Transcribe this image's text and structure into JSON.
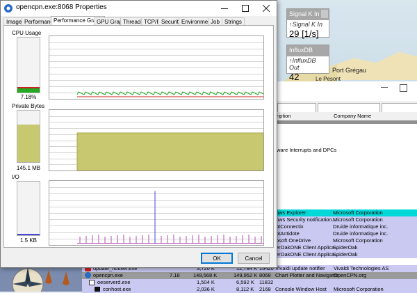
{
  "dialog": {
    "title": "opencpn.exe:8068 Properties",
    "tabs": [
      "Image",
      "Performance",
      "Performance Graph",
      "GPU Graph",
      "Threads",
      "TCP/IP",
      "Security",
      "Environment",
      "Job",
      "Strings"
    ],
    "active_tab": "Performance Graph",
    "cpu": {
      "label": "CPU Usage",
      "value": "7.18%",
      "fill_fraction": 0.07
    },
    "private_bytes": {
      "label": "Private Bytes",
      "value": "145.1 MB",
      "fill_fraction": 0.73
    },
    "io": {
      "label": "I/O",
      "value": "1.5  KB",
      "fill_fraction": 0.02
    },
    "ok_label": "OK",
    "cancel_label": "Cancel",
    "colors": {
      "cpu_kernel": "#cc2222",
      "cpu_user": "#22aa22",
      "private_bytes": "#c8c870",
      "io_line": "#4444dd",
      "io_other": "#b04fb0"
    }
  },
  "instruments": {
    "signalk": {
      "header": "Signal K In",
      "label": "↑Signal K In",
      "value": "29  [1/s]"
    },
    "influx": {
      "header": "InfluxDB",
      "label": "↑InfluxDB Out",
      "value": "42"
    }
  },
  "map": {
    "place": "Port Grégau",
    "place2": "Le Pesont"
  },
  "process_explorer": {
    "col_description": "ription",
    "col_company": "Company Name",
    "interrupts_text": "ware Interrupts and DPCs",
    "rows": [
      {
        "desc": "ows Explorer",
        "company": "Microsoft Corporation",
        "color": "#00d8d8"
      },
      {
        "desc": "ows Security notification...",
        "company": "Microsoft Corporation",
        "color": "#c9c9f2"
      },
      {
        "desc": "otConnectix",
        "company": "Druide informatique inc.",
        "color": "#c9c9f2"
      },
      {
        "desc": "otAntidote",
        "company": "Druide informatique inc.",
        "color": "#c9c9f2"
      },
      {
        "desc": "osoft OneDrive",
        "company": "Microsoft Corporation",
        "color": "#c9c9f2"
      },
      {
        "desc": "erOakONE Client Applica...",
        "company": "SpiderOak",
        "color": "#c9c9f2"
      },
      {
        "desc": "erOakONE Client Applica...",
        "company": "SpiderOak",
        "color": "#c9c9f2"
      }
    ],
    "bottom_rows": [
      {
        "name": "update_notifier.exe",
        "cpu": "",
        "priv": "3,720 K",
        "ws": "12,784 K",
        "pid": "15420",
        "desc": "Vivaldi update notifier",
        "company": "Vivaldi Technologies AS",
        "color": "#c9c9f2",
        "icon": "vivaldi-icon"
      },
      {
        "name": "opencpn.exe",
        "cpu": "7.18",
        "priv": "148,568 K",
        "ws": "149,952 K",
        "pid": "8068",
        "desc": "Chart Plotter and Navigator",
        "company": "OpenCPN.org",
        "color": "#9a9a9a",
        "icon": "opencpn-icon"
      },
      {
        "name": "oeserverd.exe",
        "cpu": "",
        "priv": "1,504 K",
        "ws": "6,592 K",
        "pid": "11832",
        "desc": "",
        "company": "",
        "color": "#c9c9f2",
        "icon": "server-icon"
      },
      {
        "name": "conhost.exe",
        "cpu": "",
        "priv": "2,036 K",
        "ws": "8,112 K",
        "pid": "2168",
        "desc": "Console Window Host",
        "company": "Microsoft Corporation",
        "color": "#c9c9f2",
        "icon": "console-icon"
      }
    ]
  }
}
